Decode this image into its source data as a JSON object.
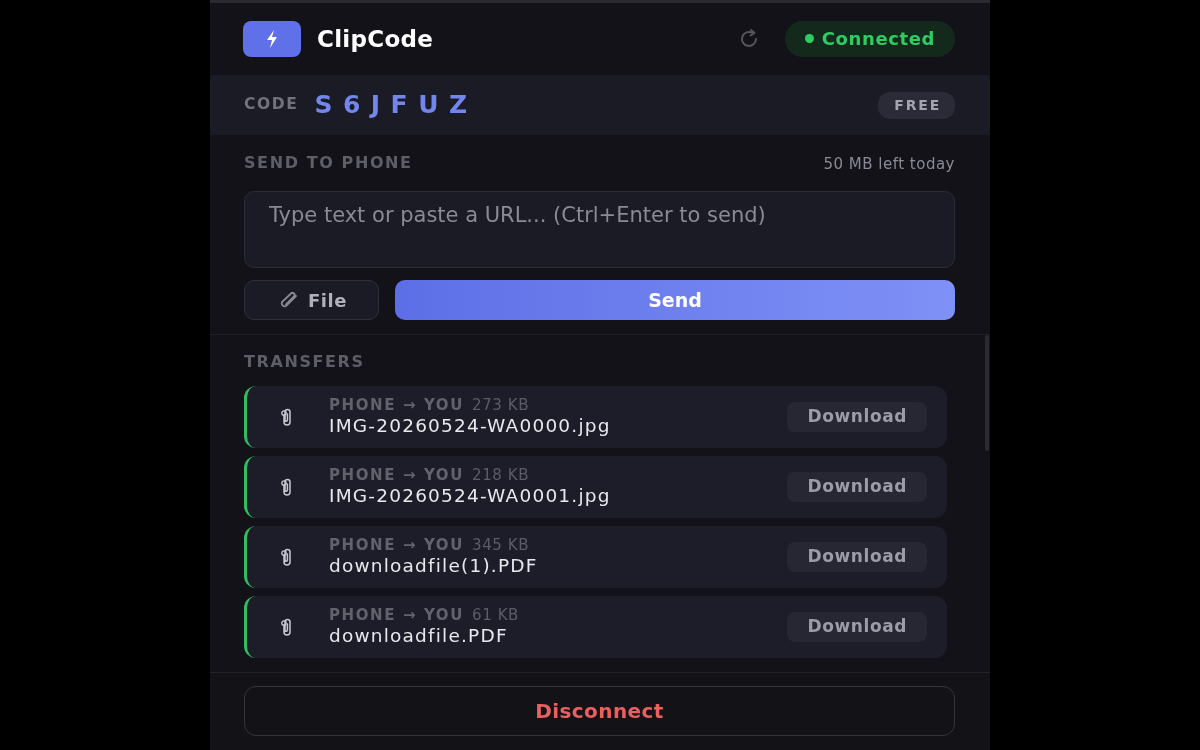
{
  "app": {
    "title": "ClipCode"
  },
  "status": {
    "label": "Connected",
    "connected": true
  },
  "session": {
    "code_label": "CODE",
    "code": "S6JFUZ",
    "plan": "FREE"
  },
  "send": {
    "heading": "SEND TO PHONE",
    "quota": "50 MB left today",
    "placeholder": "Type text or paste a URL... (Ctrl+Enter to send)",
    "file_button": "File",
    "send_button": "Send"
  },
  "transfers": {
    "heading": "TRANSFERS",
    "items": [
      {
        "direction": "PHONE → YOU",
        "size": "273 KB",
        "name": "IMG-20260524-WA0000.jpg",
        "action": "Download"
      },
      {
        "direction": "PHONE → YOU",
        "size": "218 KB",
        "name": "IMG-20260524-WA0001.jpg",
        "action": "Download"
      },
      {
        "direction": "PHONE → YOU",
        "size": "345 KB",
        "name": "downloadfile(1).PDF",
        "action": "Download"
      },
      {
        "direction": "PHONE → YOU",
        "size": "61 KB",
        "name": "downloadfile.PDF",
        "action": "Download"
      }
    ]
  },
  "footer": {
    "disconnect_button": "Disconnect"
  }
}
